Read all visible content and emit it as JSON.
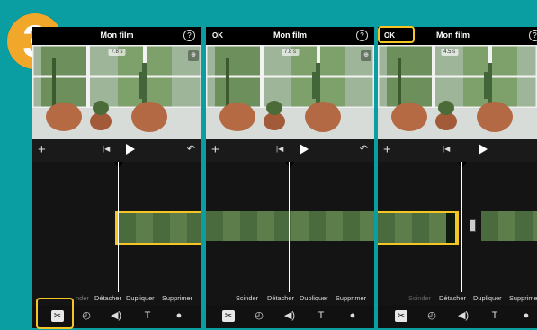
{
  "step_number": "3",
  "panels": [
    {
      "title": "Mon film",
      "ok_label": "",
      "help_icon": "?",
      "duration": "7.8 s",
      "actions": [
        "Scinder",
        "Détacher",
        "Dupliquer",
        "Supprimer"
      ],
      "actions_visible": [
        "nder",
        "Détacher",
        "Dupliquer",
        "Supprimer"
      ]
    },
    {
      "title": "Mon film",
      "ok_label": "OK",
      "help_icon": "?",
      "duration": "7.8 s",
      "actions": [
        "Scinder",
        "Détacher",
        "Dupliquer",
        "Supprimer"
      ]
    },
    {
      "title": "Mon film",
      "ok_label": "OK",
      "help_icon": "?",
      "duration": "4.5 s",
      "actions": [
        "Scinder",
        "Détacher",
        "Dupliquer",
        "Supprime"
      ]
    }
  ],
  "colors": {
    "background": "#0a9ea2",
    "highlight": "#f5c526",
    "step_badge": "#f1a72a"
  },
  "icons": [
    "plus-icon",
    "skip-back-icon",
    "play-icon",
    "undo-icon",
    "zoom-icon",
    "scissors-icon",
    "speed-icon",
    "volume-icon",
    "text-icon",
    "filters-icon"
  ]
}
